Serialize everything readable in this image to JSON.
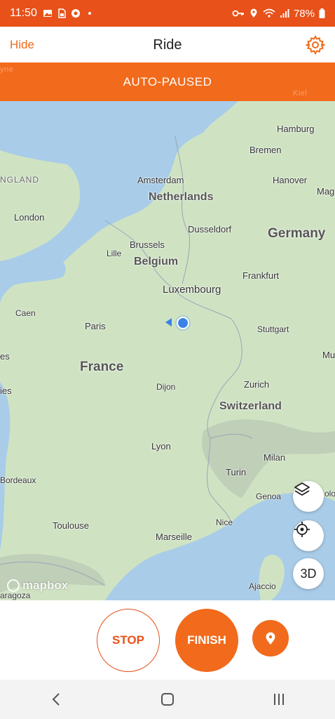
{
  "status_bar": {
    "time": "11:50",
    "battery": "78%"
  },
  "header": {
    "hide_label": "Hide",
    "title": "Ride"
  },
  "banner": {
    "text": "AUTO-PAUSED"
  },
  "map": {
    "attribution": "mapbox",
    "labels": {
      "hamburg": "Hamburg",
      "bremen": "Bremen",
      "kiel": "Kiel",
      "england": "NGLAND",
      "amsterdam": "Amsterdam",
      "hanover": "Hanover",
      "mag": "Mag",
      "netherlands": "Netherlands",
      "london": "London",
      "dusseldorf": "Dusseldorf",
      "germany": "Germany",
      "brussels": "Brussels",
      "lille": "Lille",
      "belgium": "Belgium",
      "frankfurt": "Frankfurt",
      "luxembourg": "Luxembourg",
      "caen": "Caen",
      "paris": "Paris",
      "stuttgart": "Stuttgart",
      "es": "es",
      "mu": "Mu",
      "france": "France",
      "zurich": "Zurich",
      "dijon": "Dijon",
      "ies": "ies",
      "switzerland": "Switzerland",
      "lyon": "Lyon",
      "milan": "Milan",
      "turin": "Turin",
      "bordeaux": "Bordeaux",
      "genoa": "Genoa",
      "bolo": "olo",
      "toulouse": "Toulouse",
      "nice": "Nice",
      "marseille": "Marseille",
      "ajaccio": "Ajaccio",
      "zaragoza": "aragoza",
      "yne": "yne"
    },
    "buttons": {
      "layers_icon": "layers-icon",
      "locate_icon": "locate-icon",
      "three_d": "3D"
    }
  },
  "controls": {
    "stop_label": "STOP",
    "finish_label": "FINISH",
    "pin_icon": "location-pin-icon"
  },
  "nav_bar": {
    "back_icon": "back-icon",
    "home_icon": "home-icon",
    "recents_icon": "recents-icon"
  },
  "colors": {
    "accent": "#f26a1b",
    "status_bar": "#e8511a",
    "water": "#a9cce8",
    "land": "#cfe3c3",
    "user_dot": "#3b82e6"
  }
}
